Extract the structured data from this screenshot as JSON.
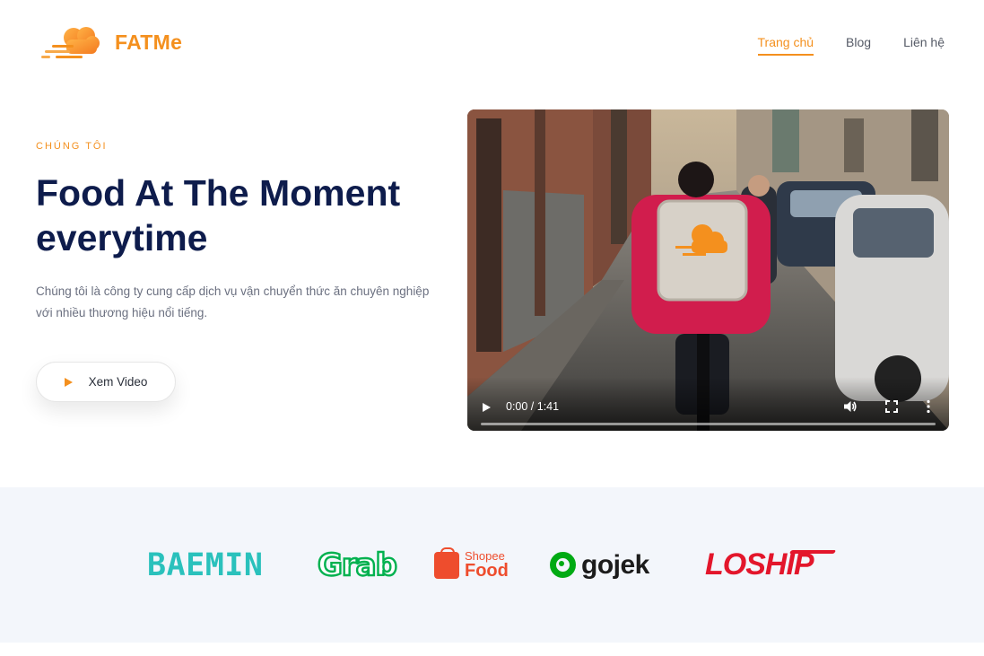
{
  "brand": {
    "name": "FATMe",
    "accent": "#f4901e",
    "dark": "#0e1c4c"
  },
  "nav": {
    "items": [
      {
        "label": "Trang chủ",
        "active": true
      },
      {
        "label": "Blog",
        "active": false
      },
      {
        "label": "Liên hệ",
        "active": false
      }
    ]
  },
  "hero": {
    "eyebrow": "CHÚNG TÔI",
    "title_line1": "Food At The Moment",
    "title_line2": "everytime",
    "description": "Chúng tôi là công ty cung cấp dịch vụ vận chuyển thức ăn chuyên nghiệp với nhiều thương hiệu nổi tiếng.",
    "video_button_label": "Xem Video"
  },
  "video": {
    "time": "0:00 / 1:41",
    "progress": 0,
    "icons": [
      "play-icon",
      "volume-icon",
      "fullscreen-icon",
      "more-options-icon"
    ]
  },
  "partners": {
    "items": [
      {
        "name": "BAEMIN",
        "color": "#2ac1bc"
      },
      {
        "name": "Grab",
        "color": "#00b14f"
      },
      {
        "name_top": "Shopee",
        "name_bottom": "Food",
        "color": "#ee4d2d"
      },
      {
        "name": "gojek",
        "color": "#00aa13"
      },
      {
        "name": "LOSHIP",
        "color": "#e3162b"
      }
    ]
  }
}
